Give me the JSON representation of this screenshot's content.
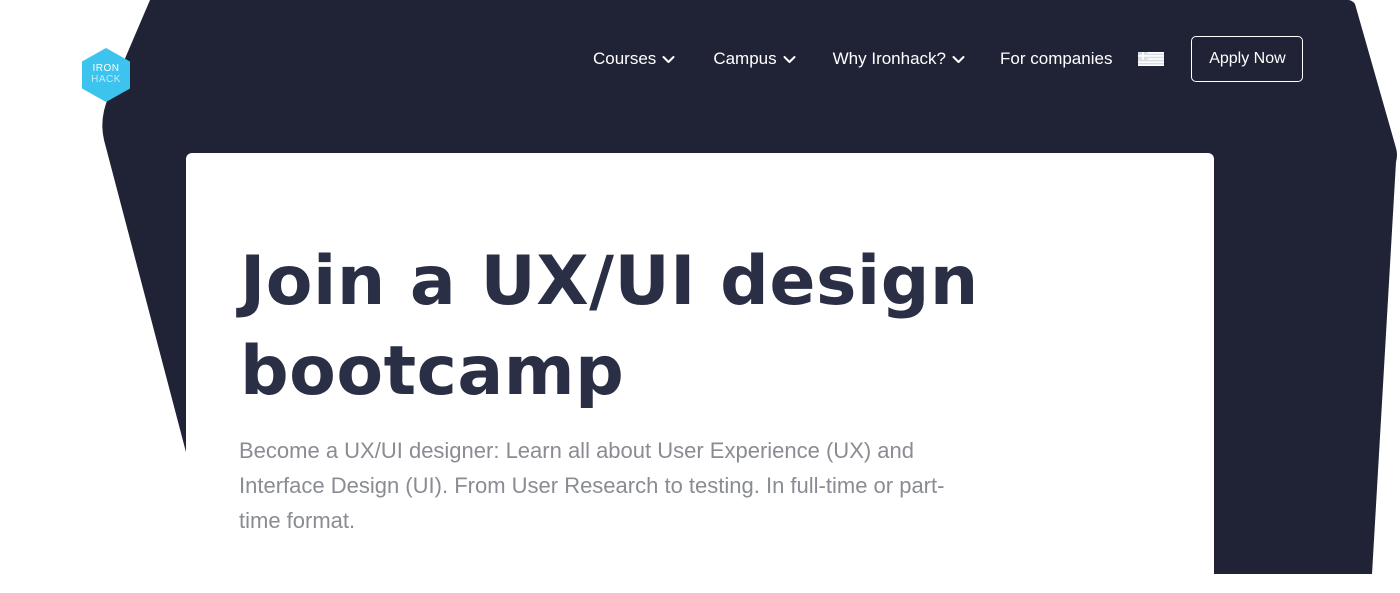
{
  "brand": {
    "logo_line1": "IRON",
    "logo_line2": "HACK",
    "logo_color": "#3cc4ef"
  },
  "nav": {
    "items": [
      {
        "label": "Courses",
        "icon": "chevron-down-icon"
      },
      {
        "label": "Campus",
        "icon": "chevron-down-icon"
      },
      {
        "label": "Why Ironhack?",
        "icon": "chevron-down-icon"
      },
      {
        "label": "For companies"
      }
    ],
    "language_flag": "greece-flag-icon",
    "apply_label": "Apply Now"
  },
  "hero": {
    "title": "Join a UX/UI design bootcamp",
    "description": "Become a UX/UI designer: Learn all about User Experience (UX) and Interface Design (UI). From User Research to testing. In full-time or part-time format."
  },
  "colors": {
    "background_dark": "#1f2335",
    "title": "#2a2f45",
    "body_text": "#8a8c94",
    "accent": "#3cc4ef"
  }
}
